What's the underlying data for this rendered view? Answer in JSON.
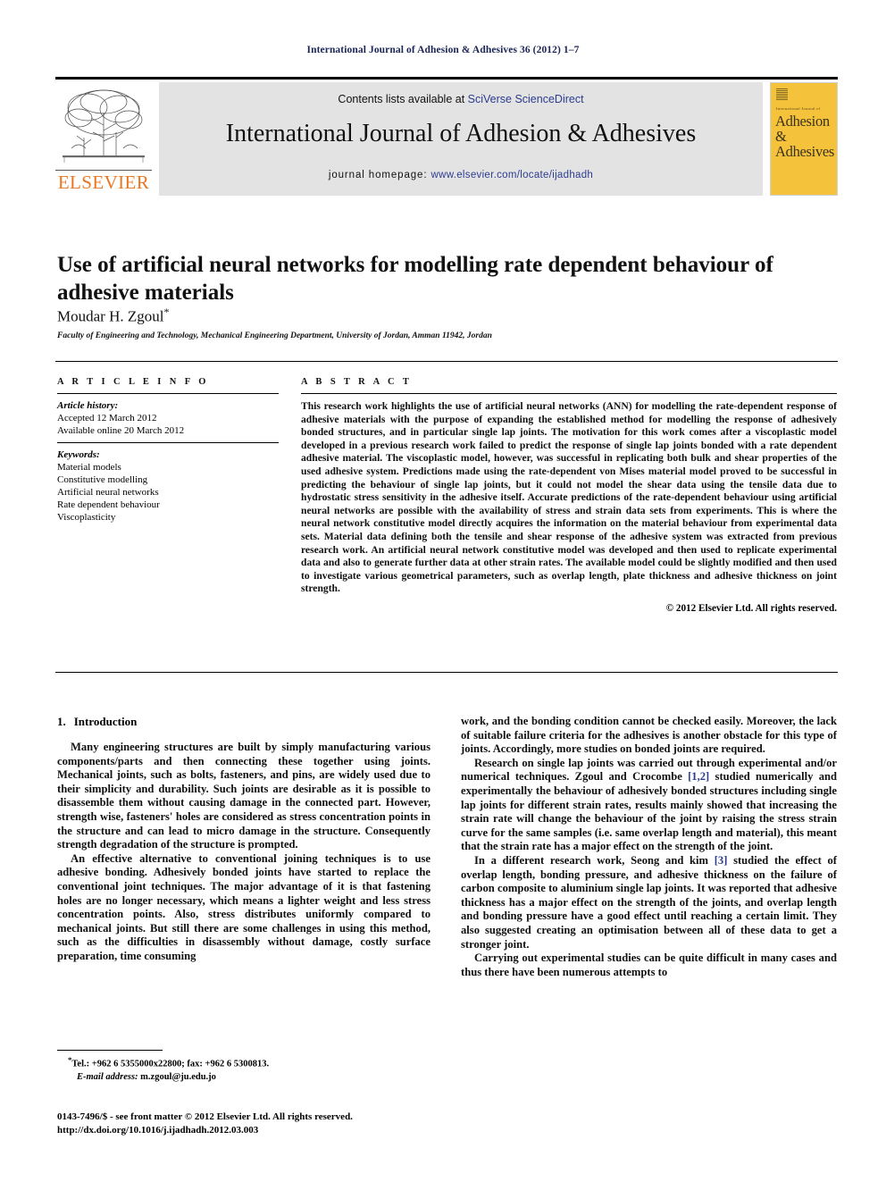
{
  "running_head": "International Journal of Adhesion & Adhesives 36 (2012) 1–7",
  "masthead": {
    "publisher_name": "ELSEVIER",
    "contents_prefix": "Contents lists available at ",
    "contents_link": "SciVerse ScienceDirect",
    "journal_title": "International Journal of Adhesion & Adhesives",
    "homepage_prefix": "journal homepage: ",
    "homepage_url": "www.elsevier.com/locate/ijadhadh",
    "cover": {
      "small_line": "International Journal of",
      "line1": "Adhesion &",
      "line2": "Adhesives",
      "bg_color": "#F5C23B"
    },
    "link_color": "#2c3c8f"
  },
  "article": {
    "title": "Use of artificial neural networks for modelling rate dependent behaviour of adhesive materials",
    "authors": "Moudar H. Zgoul",
    "author_marker": "*",
    "affiliation": "Faculty of Engineering and Technology, Mechanical Engineering Department, University of Jordan, Amman 11942, Jordan"
  },
  "article_info": {
    "heading": "A R T I C L E   I N F O",
    "history_label": "Article history:",
    "history_lines": [
      "Accepted 12 March 2012",
      "Available online 20 March 2012"
    ],
    "keywords_label": "Keywords:",
    "keywords": [
      "Material models",
      "Constitutive modelling",
      "Artificial neural networks",
      "Rate dependent behaviour",
      "Viscoplasticity"
    ]
  },
  "abstract": {
    "heading": "A B S T R A C T",
    "text": "This research work highlights the use of artificial neural networks (ANN) for modelling the rate-dependent response of adhesive materials with the purpose of expanding the established method for modelling the response of adhesively bonded structures, and in particular single lap joints. The motivation for this work comes after a viscoplastic model developed in a previous research work failed to predict the response of single lap joints bonded with a rate dependent adhesive material. The viscoplastic model, however, was successful in replicating both bulk and shear properties of the used adhesive system. Predictions made using the rate-dependent von Mises material model proved to be successful in predicting the behaviour of single lap joints, but it could not model the shear data using the tensile data due to hydrostatic stress sensitivity in the adhesive itself. Accurate predictions of the rate-dependent behaviour using artificial neural networks are possible with the availability of stress and strain data sets from experiments. This is where the neural network constitutive model directly acquires the information on the material behaviour from experimental data sets. Material data defining both the tensile and shear response of the adhesive system was extracted from previous research work. An artificial neural network constitutive model was developed and then used to replicate experimental data and also to generate further data at other strain rates. The available model could be slightly modified and then used to investigate various geometrical parameters, such as overlap length, plate thickness and adhesive thickness on joint strength.",
    "copyright": "© 2012 Elsevier Ltd. All rights reserved."
  },
  "body": {
    "section_number": "1.",
    "section_title": "Introduction",
    "left_paragraphs": [
      "Many engineering structures are built by simply manufacturing various components/parts and then connecting these together using joints. Mechanical joints, such as bolts, fasteners, and pins, are widely used due to their simplicity and durability. Such joints are desirable as it is possible to disassemble them without causing damage in the connected part. However, strength wise, fasteners' holes are considered as stress concentration points in the structure and can lead to micro damage in the structure. Consequently strength degradation of the structure is prompted.",
      "An effective alternative to conventional joining techniques is to use adhesive bonding. Adhesively bonded joints have started to replace the conventional joint techniques. The major advantage of it is that fastening holes are no longer necessary, which means a lighter weight and less stress concentration points. Also, stress distributes uniformly compared to mechanical joints. But still there are some challenges in using this method, such as the difficulties in disassembly without damage, costly surface preparation, time consuming"
    ],
    "right_paragraphs": [
      {
        "indent": false,
        "parts": [
          {
            "text": "work, and the bonding condition cannot be checked easily. Moreover, the lack of suitable failure criteria for the adhesives is another obstacle for this type of joints. Accordingly, more studies on bonded joints are required."
          }
        ]
      },
      {
        "indent": true,
        "parts": [
          {
            "text": "Research on single lap joints was carried out through experimental and/or numerical techniques. Zgoul and Crocombe "
          },
          {
            "text": "[1,2]",
            "link": true
          },
          {
            "text": " studied numerically and experimentally the behaviour of adhesively bonded structures including single lap joints for different strain rates, results mainly showed that increasing the strain rate will change the behaviour of the joint by raising the stress strain curve for the same samples (i.e. same overlap length and material), this meant that the strain rate has a major effect on the strength of the joint."
          }
        ]
      },
      {
        "indent": true,
        "parts": [
          {
            "text": "In a different research work, Seong and kim "
          },
          {
            "text": "[3]",
            "link": true
          },
          {
            "text": " studied the effect of overlap length, bonding pressure, and adhesive thickness on the failure of carbon composite to aluminium single lap joints. It was reported that adhesive thickness has a major effect on the strength of the joints, and overlap length and bonding pressure have a good effect until reaching a certain limit. They also suggested creating an optimisation between all of these data to get a stronger joint."
          }
        ]
      },
      {
        "indent": true,
        "parts": [
          {
            "text": "Carrying out experimental studies can be quite difficult in many cases and thus there have been numerous attempts to"
          }
        ]
      }
    ]
  },
  "footnote": {
    "marker": "*",
    "tel_line": "Tel.: +962 6 5355000x22800; fax: +962 6 5300813.",
    "email_label": "E-mail address:",
    "email": "m.zgoul@ju.edu.jo"
  },
  "imprint": {
    "line1": "0143-7496/$ - see front matter © 2012 Elsevier Ltd. All rights reserved.",
    "line2": "http://dx.doi.org/10.1016/j.ijadhadh.2012.03.003"
  }
}
